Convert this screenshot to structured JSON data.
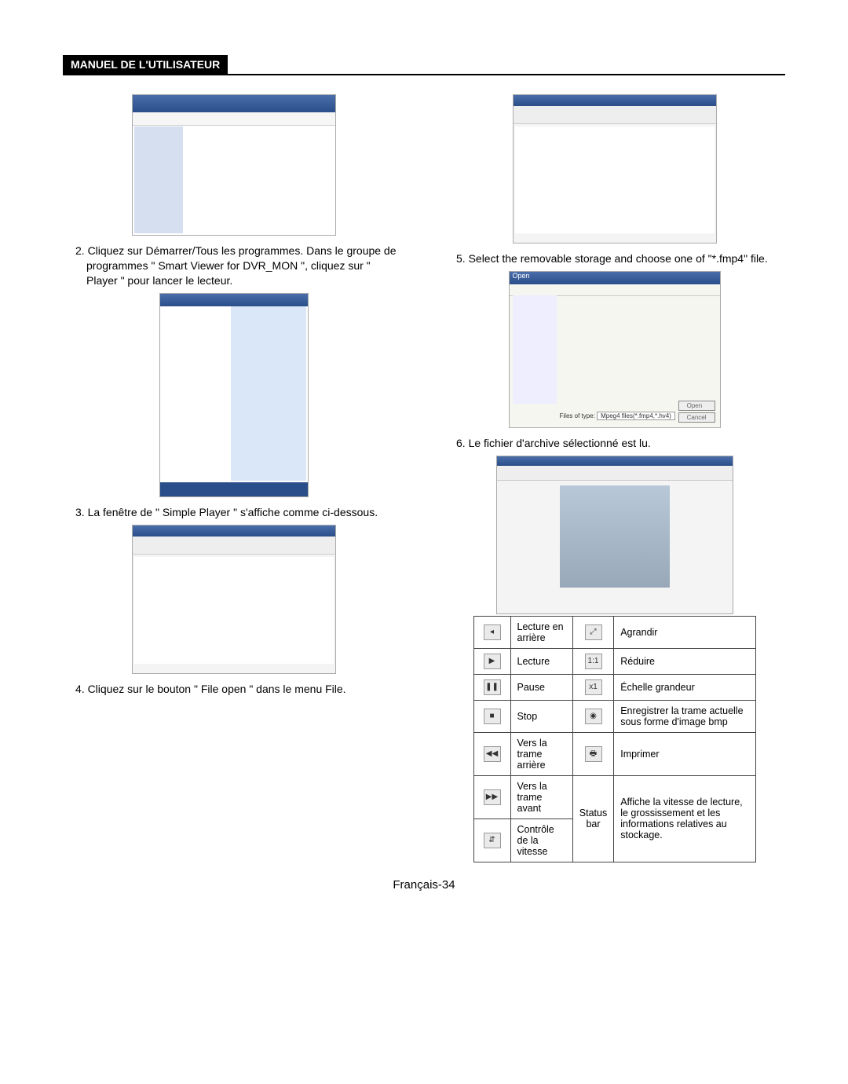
{
  "header": {
    "title": "MANUEL DE L'UTILISATEUR"
  },
  "left": {
    "step2": "2. Cliquez sur Démarrer/Tous les programmes. Dans le groupe de programmes \" Smart Viewer for DVR_MON \", cliquez sur \" Player \" pour lancer le lecteur.",
    "step3": "3. La fenêtre de \" Simple Player \" s'affiche comme ci-dessous.",
    "step4": "4. Cliquez sur le bouton \" File open \" dans le menu File."
  },
  "right": {
    "step5": "5. Select the removable storage and choose one of \"*.fmp4\" file.",
    "step6": "6. Le fichier d'archive sélectionné est lu."
  },
  "openDialog": {
    "title": "Open",
    "filterLabel": "Files of type:",
    "filter": "Mpeg4 files(*.fmp4,*.hv4)",
    "open": "Open",
    "cancel": "Cancel"
  },
  "buttonsTable": {
    "rows": [
      {
        "iconL": "◂",
        "labelL": "Lecture en arrière",
        "iconR": "⤢",
        "labelR": "Agrandir"
      },
      {
        "iconL": "▶",
        "labelL": "Lecture",
        "iconR": "1:1",
        "labelR": "Réduire"
      },
      {
        "iconL": "❚❚",
        "labelL": "Pause",
        "iconR": "x1",
        "labelR": "Échelle grandeur"
      },
      {
        "iconL": "■",
        "labelL": "Stop",
        "iconR": "◉",
        "labelR": "Enregistrer la trame actuelle sous forme d'image bmp"
      },
      {
        "iconL": "◀◀",
        "labelL": "Vers la trame arrière",
        "iconR": "🖶",
        "labelR": "Imprimer"
      },
      {
        "iconL": "▶▶",
        "labelL": "Vers la trame avant",
        "iconR": "Status bar",
        "labelR": "Affiche la vitesse de lecture, le grossissement et les informations relatives au stockage.",
        "mergeR": true
      },
      {
        "iconL": "⇵",
        "labelL": "Contrôle de la vitesse"
      }
    ]
  },
  "footer": "Français-34"
}
